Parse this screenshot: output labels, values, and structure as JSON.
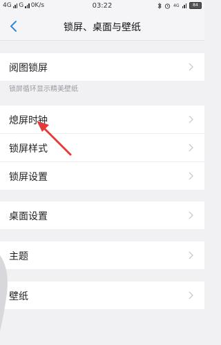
{
  "status_bar": {
    "left_text": "4G .ıll G .ıll 0K/s",
    "time": "03:22",
    "battery": "84",
    "network_right": "4G"
  },
  "header": {
    "title": "锁屏、桌面与壁纸",
    "back_icon": "chevron-left-icon"
  },
  "section1": {
    "items": [
      {
        "label": "阅图锁屏"
      }
    ],
    "hint": "锁屏循环显示精美壁纸"
  },
  "section2": {
    "items": [
      {
        "label": "熄屏时钟"
      },
      {
        "label": "锁屏样式"
      },
      {
        "label": "锁屏设置"
      }
    ]
  },
  "section3": {
    "items": [
      {
        "label": "桌面设置"
      }
    ]
  },
  "section4": {
    "items": [
      {
        "label": "主题"
      }
    ]
  },
  "section5": {
    "items": [
      {
        "label": "壁纸"
      }
    ]
  },
  "colors": {
    "accent": "#2f86d8",
    "annotation_arrow": "#e23b3b",
    "background": "#f1f1f3"
  }
}
